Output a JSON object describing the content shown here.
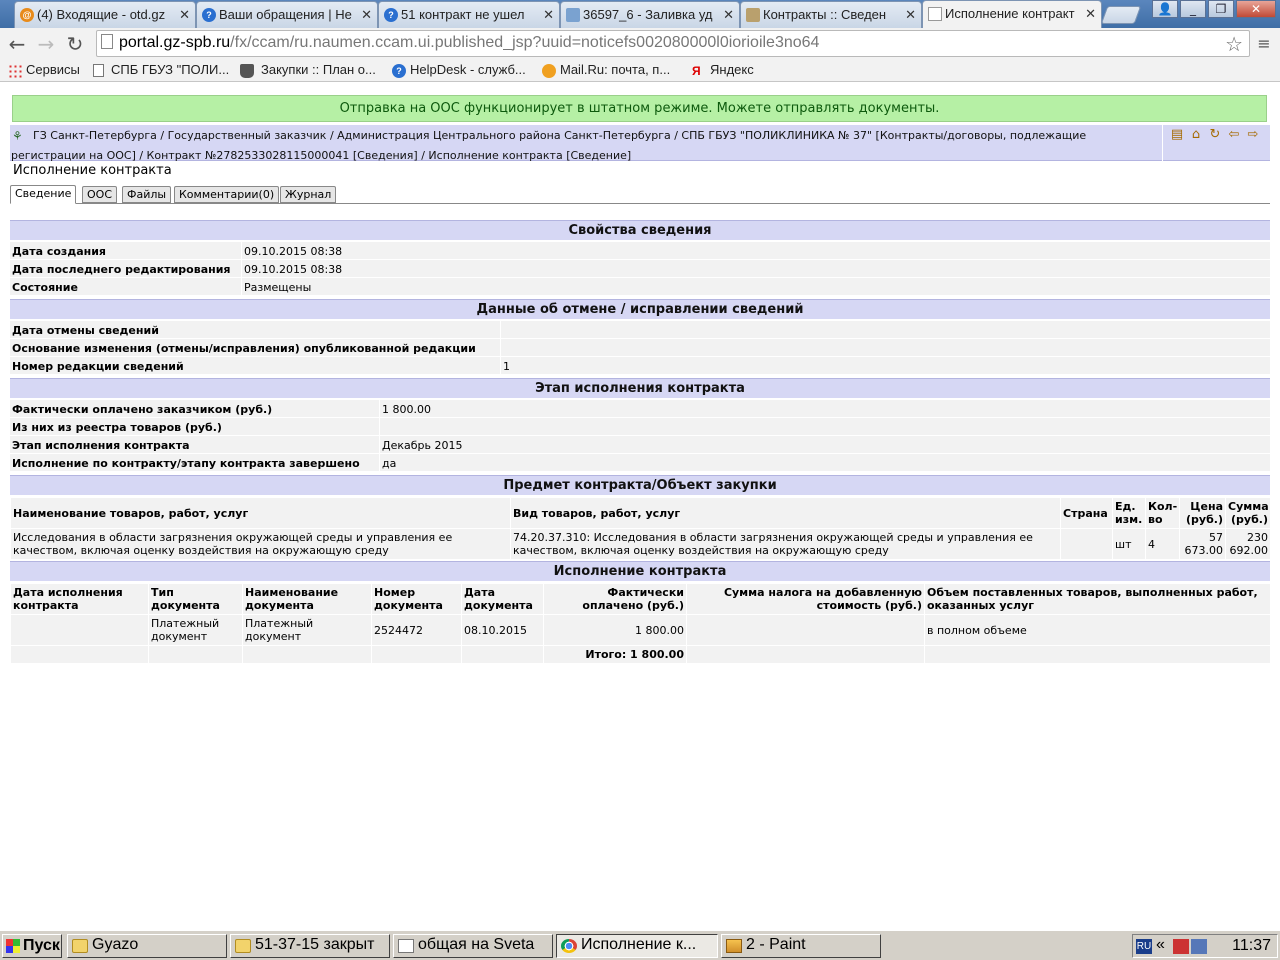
{
  "browser": {
    "tabs": [
      {
        "title": "(4) Входящие - otd.gz",
        "icon": "mail"
      },
      {
        "title": "Ваши обращения | Не",
        "icon": "helpdesk"
      },
      {
        "title": "51 контракт не ушел",
        "icon": "helpdesk"
      },
      {
        "title": "36597_6 - Заливка уд",
        "icon": "image"
      },
      {
        "title": "Контракты :: Сведен",
        "icon": "tool"
      },
      {
        "title": "Исполнение контракт",
        "icon": "doc"
      }
    ],
    "active_tab": 5,
    "url_host": "portal.gz-spb.ru",
    "url_path": "/fx/ccam/ru.naumen.ccam.ui.published_jsp?uuid=noticefs002080000l0iorioile3no64",
    "bookmarks": [
      {
        "label": "Сервисы",
        "icon": "apps"
      },
      {
        "label": "СПБ ГБУЗ \"ПОЛИ...",
        "icon": "page"
      },
      {
        "label": "Закупки :: План о...",
        "icon": "basket"
      },
      {
        "label": "HelpDesk - служб...",
        "icon": "helpdesk"
      },
      {
        "label": "Mail.Ru: почта, п...",
        "icon": "mail"
      },
      {
        "label": "Яндекс",
        "icon": "yandex"
      }
    ]
  },
  "page": {
    "notice": "Отправка на ООС функционирует в штатном режиме. Можете отправлять документы.",
    "breadcrumb": "ГЗ Санкт-Петербурга / Государственный заказчик / Администрация Центрального района Санкт-Петербурга / СПБ ГБУЗ \"ПОЛИКЛИНИКА № 37\" [Контракты/договоры, подлежащие регистрации на ООС] / Контракт №2782533028115000041 [Сведения] / Исполнение контракта [Сведение]",
    "title": "Исполнение контракта",
    "tabs": [
      "Сведение",
      "ООС",
      "Файлы",
      "Комментарии(0)",
      "Журнал"
    ],
    "sections": {
      "props": {
        "heading": "Свойства сведения",
        "rows": [
          {
            "label": "Дата создания",
            "value": "09.10.2015 08:38"
          },
          {
            "label": "Дата последнего редактирования",
            "value": "09.10.2015 08:38"
          },
          {
            "label": "Состояние",
            "value": "Размещены"
          }
        ]
      },
      "cancel": {
        "heading": "Данные об отмене / исправлении сведений",
        "rows": [
          {
            "label": "Дата отмены сведений",
            "value": ""
          },
          {
            "label": "Основание изменения (отмены/исправления) опубликованной редакции",
            "value": ""
          },
          {
            "label": "Номер редакции сведений",
            "value": "1"
          }
        ]
      },
      "stage": {
        "heading": "Этап исполнения контракта",
        "rows": [
          {
            "label": "Фактически оплачено заказчиком (руб.)",
            "value": "1 800.00"
          },
          {
            "label": "Из них из реестра товаров (руб.)",
            "value": ""
          },
          {
            "label": "Этап исполнения контракта",
            "value": "Декабрь 2015"
          },
          {
            "label": "Исполнение по контракту/этапу контракта завершено",
            "value": "да"
          }
        ]
      },
      "subject": {
        "heading": "Предмет контракта/Объект закупки",
        "columns": [
          "Наименование товаров, работ, услуг",
          "Вид товаров, работ, услуг",
          "Страна",
          "Ед. изм.",
          "Кол-во",
          "Цена (руб.)",
          "Сумма (руб.)"
        ],
        "rows": [
          [
            "Исследования в области загрязнения окружающей среды и управления ее качеством, включая оценку воздействия на окружающую среду",
            "74.20.37.310: Исследования в области загрязнения окружающей среды и управления ее качеством, включая оценку воздействия на окружающую среду",
            "",
            "шт",
            "4",
            "57 673.00",
            "230 692.00"
          ]
        ]
      },
      "execution": {
        "heading": "Исполнение контракта",
        "columns": [
          "Дата исполнения контракта",
          "Тип документа",
          "Наименование документа",
          "Номер документа",
          "Дата документа",
          "Фактически оплачено (руб.)",
          "Сумма налога на добавленную стоимость (руб.)",
          "Объем поставленных товаров, выполненных работ, оказанных услуг"
        ],
        "rows": [
          [
            "",
            "Платежный документ",
            "Платежный документ",
            "2524472",
            "08.10.2015",
            "1 800.00",
            "",
            "в полном объеме"
          ]
        ],
        "total": "Итого: 1 800.00"
      }
    }
  },
  "taskbar": {
    "start": "Пуск",
    "tasks": [
      {
        "label": "Gyazo",
        "icon": "folder"
      },
      {
        "label": "51-37-15 закрыт",
        "icon": "folder"
      },
      {
        "label": "общая на Sveta",
        "icon": "notepad"
      },
      {
        "label": "Исполнение к...",
        "icon": "chrome"
      },
      {
        "label": "2 - Paint",
        "icon": "paint"
      }
    ],
    "active_task": 3,
    "lang": "RU",
    "clock": "11:37"
  }
}
